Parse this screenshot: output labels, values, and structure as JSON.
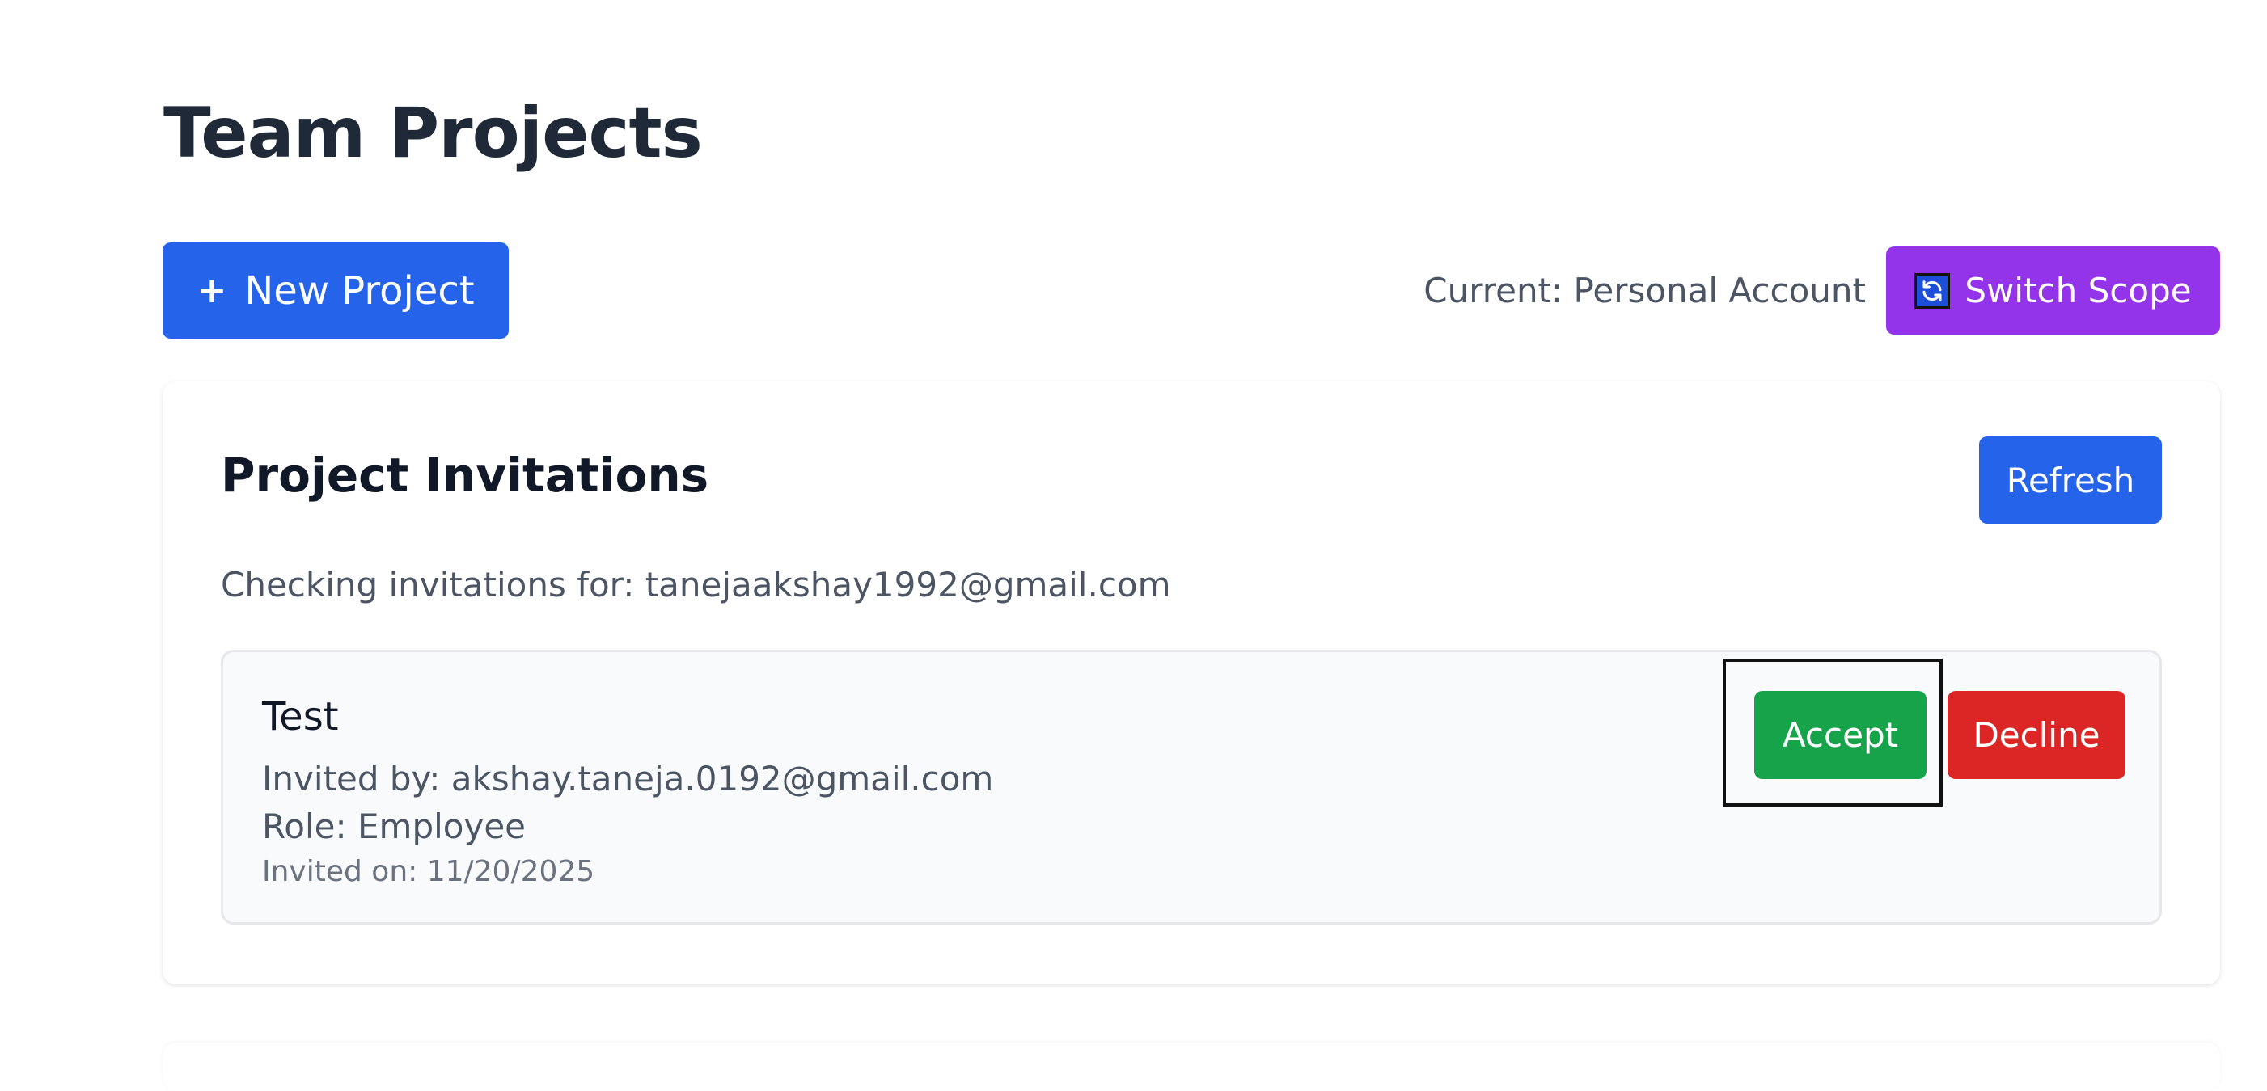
{
  "page": {
    "title": "Team Projects"
  },
  "toolbar": {
    "new_project_label": "New Project",
    "new_project_icon": "plus-icon",
    "scope_text": "Current: Personal Account",
    "switch_scope_label": "Switch Scope",
    "switch_scope_icon": "refresh-icon"
  },
  "invitations": {
    "title": "Project Invitations",
    "refresh_label": "Refresh",
    "checking_text": "Checking invitations for: tanejaakshay1992@gmail.com",
    "items": [
      {
        "project_name": "Test",
        "invited_by": "Invited by: akshay.taneja.0192@gmail.com",
        "role": "Role: Employee",
        "invited_on": "Invited on: 11/20/2025",
        "accept_label": "Accept",
        "decline_label": "Decline"
      }
    ]
  },
  "colors": {
    "primary": "#2563eb",
    "purple": "#9333ea",
    "success": "#16a34a",
    "danger": "#dc2626",
    "heading": "#1f2937",
    "muted": "#4b5563"
  }
}
